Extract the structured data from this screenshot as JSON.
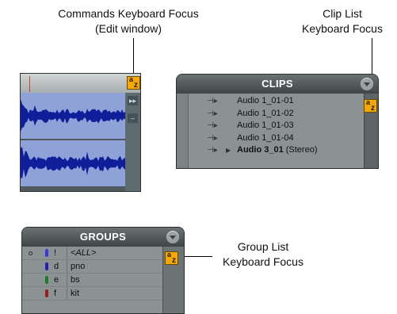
{
  "callouts": {
    "commands": {
      "line1": "Commands Keyboard Focus",
      "line2": "(Edit window)"
    },
    "clip_list": {
      "line1": "Clip List",
      "line2": "Keyboard Focus"
    },
    "group_list": {
      "line1": "Group List",
      "line2": "Keyboard Focus"
    }
  },
  "focus_badge": {
    "top": "a",
    "bottom": "z",
    "color": "#f5a800"
  },
  "edit_window": {
    "side_buttons": [
      "▸▸",
      "–"
    ]
  },
  "clips_panel": {
    "title": "CLIPS",
    "items": [
      {
        "name": "Audio 1_01-01",
        "bold": false,
        "suffix": ""
      },
      {
        "name": "Audio 1_01-02",
        "bold": false,
        "suffix": ""
      },
      {
        "name": "Audio 1_01-03",
        "bold": false,
        "suffix": ""
      },
      {
        "name": "Audio 1_01-04",
        "bold": false,
        "suffix": ""
      },
      {
        "name": "Audio 3_01",
        "bold": true,
        "suffix": " (Stereo)"
      }
    ]
  },
  "groups_panel": {
    "title": "GROUPS",
    "rows": [
      {
        "letter": "!",
        "name": "<ALL>",
        "color": "#3a3ae0",
        "italic": true
      },
      {
        "letter": "d",
        "name": "pno",
        "color": "#2020b0",
        "italic": false
      },
      {
        "letter": "e",
        "name": "bs",
        "color": "#1f7a2a",
        "italic": false
      },
      {
        "letter": "f",
        "name": "kit",
        "color": "#9a1e1e",
        "italic": false
      }
    ]
  }
}
